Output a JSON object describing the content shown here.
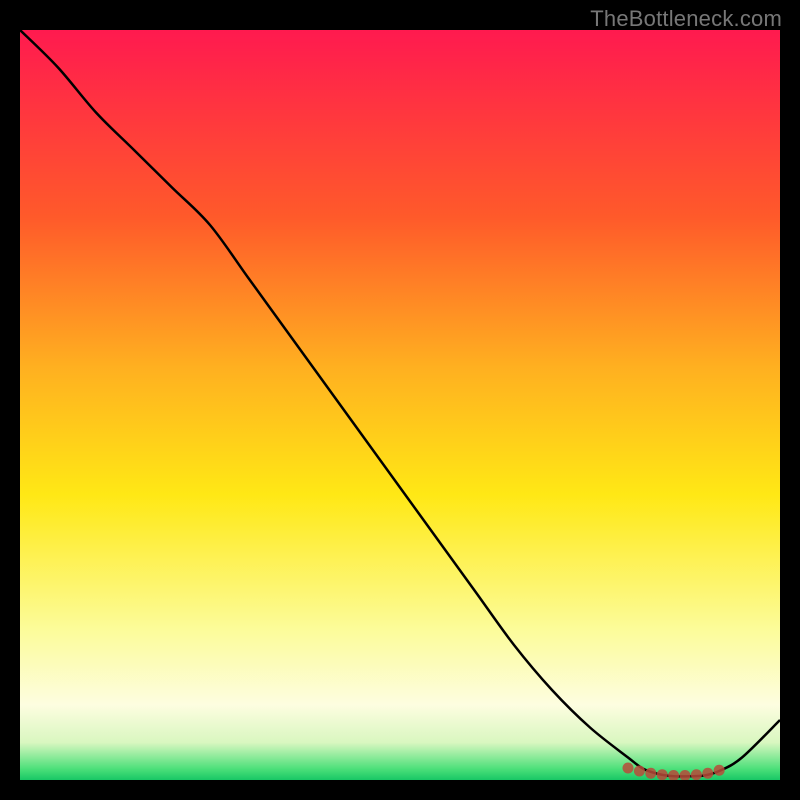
{
  "watermark": "TheBottleneck.com",
  "chart_data": {
    "type": "line",
    "title": "",
    "xlabel": "",
    "ylabel": "",
    "xlim": [
      0,
      100
    ],
    "ylim": [
      0,
      100
    ],
    "series": [
      {
        "name": "bottleneck-curve",
        "x": [
          0,
          5,
          10,
          15,
          20,
          25,
          30,
          35,
          40,
          45,
          50,
          55,
          60,
          65,
          70,
          75,
          80,
          82,
          84,
          86,
          88,
          90,
          92,
          95,
          100
        ],
        "y": [
          100,
          95,
          89,
          84,
          79,
          74,
          67,
          60,
          53,
          46,
          39,
          32,
          25,
          18,
          12,
          7,
          3,
          1.5,
          0.8,
          0.5,
          0.5,
          0.6,
          1.2,
          3,
          8
        ]
      }
    ],
    "markers": {
      "name": "optimum-band",
      "x": [
        80,
        81.5,
        83,
        84.5,
        86,
        87.5,
        89,
        90.5,
        92
      ],
      "y": [
        1.6,
        1.2,
        0.9,
        0.7,
        0.6,
        0.6,
        0.7,
        0.9,
        1.3
      ],
      "color": "#b84a3a"
    },
    "gradient_stops": [
      {
        "offset": 0,
        "color": "#ff1a4f"
      },
      {
        "offset": 0.25,
        "color": "#ff5a2a"
      },
      {
        "offset": 0.45,
        "color": "#ffb020"
      },
      {
        "offset": 0.62,
        "color": "#ffe815"
      },
      {
        "offset": 0.8,
        "color": "#fcfc9a"
      },
      {
        "offset": 0.9,
        "color": "#fdfde0"
      },
      {
        "offset": 0.95,
        "color": "#d9f7c0"
      },
      {
        "offset": 0.985,
        "color": "#4de07a"
      },
      {
        "offset": 1.0,
        "color": "#18c765"
      }
    ]
  }
}
